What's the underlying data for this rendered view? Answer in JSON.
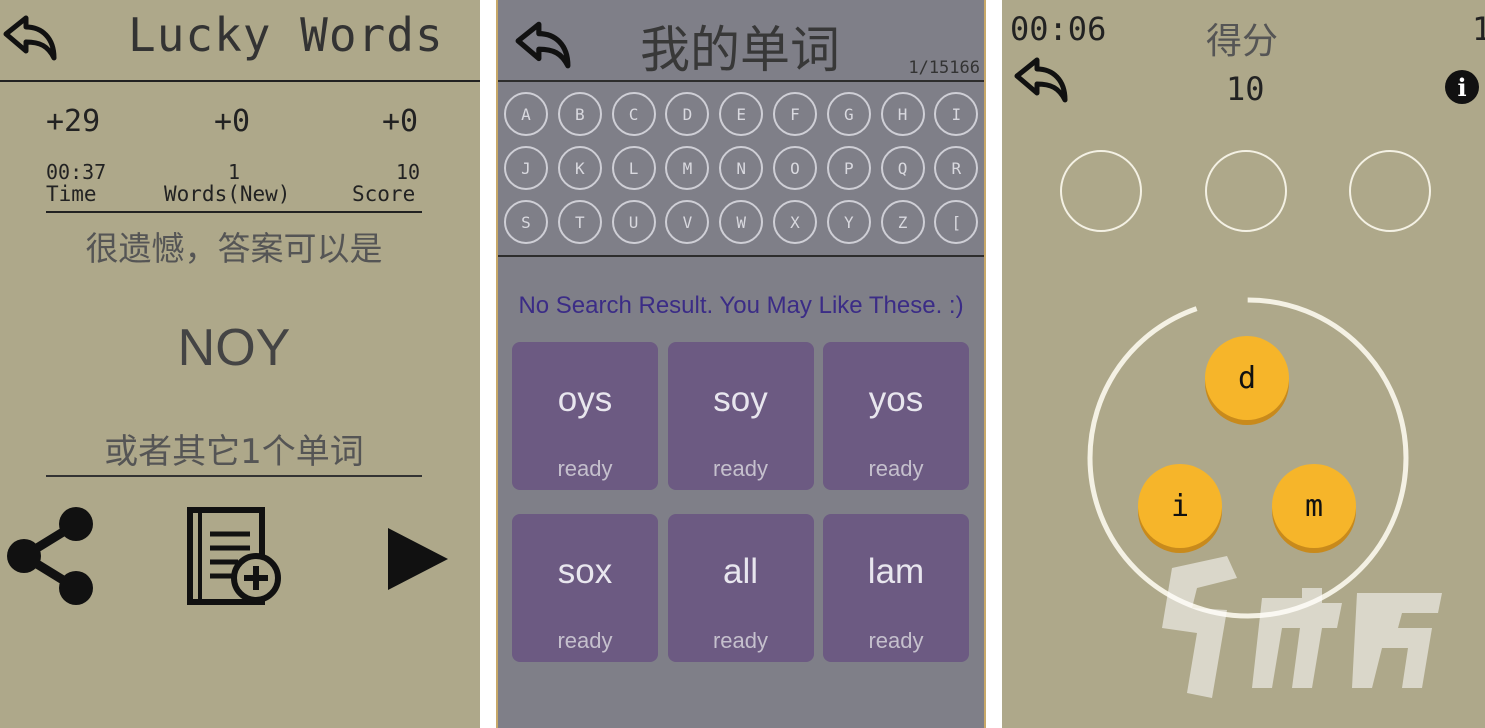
{
  "panel1": {
    "title": "Lucky Words",
    "deltas": [
      "+29",
      "+0",
      "+0"
    ],
    "stats": [
      {
        "value": "00:37",
        "label": "Time"
      },
      {
        "value": "1",
        "label": "Words(New)"
      },
      {
        "value": "10",
        "label": "Score"
      }
    ],
    "message": "很遗憾，答案可以是",
    "answer": "NOY",
    "other_words": "或者其它1个单词",
    "icons": [
      "back-arrow-icon",
      "share-icon",
      "add-to-wordbook-icon",
      "play-icon"
    ]
  },
  "panel2": {
    "title": "我的单词",
    "count": "1/15166",
    "keys": [
      "A",
      "B",
      "C",
      "D",
      "E",
      "F",
      "G",
      "H",
      "I",
      "J",
      "K",
      "L",
      "M",
      "N",
      "O",
      "P",
      "Q",
      "R",
      "S",
      "T",
      "U",
      "V",
      "W",
      "X",
      "Y",
      "Z",
      "["
    ],
    "no_result": "No Search Result. You May Like These. :)",
    "words": [
      {
        "word": "oys",
        "status": "ready"
      },
      {
        "word": "soy",
        "status": "ready"
      },
      {
        "word": "yos",
        "status": "ready"
      },
      {
        "word": "sox",
        "status": "ready"
      },
      {
        "word": "all",
        "status": "ready"
      },
      {
        "word": "lam",
        "status": "ready"
      }
    ],
    "colors": {
      "background": "#7f7f88",
      "tile": "#6c5a82",
      "hint_text": "#3b2c86"
    }
  },
  "panel3": {
    "timer": "00:06",
    "score_label": "得分",
    "corner_text": "1",
    "score_value": "10",
    "info": "i",
    "letters": [
      "d",
      "i",
      "m"
    ],
    "colors": {
      "background": "#aea88a",
      "tile": "#f6b52a"
    }
  }
}
